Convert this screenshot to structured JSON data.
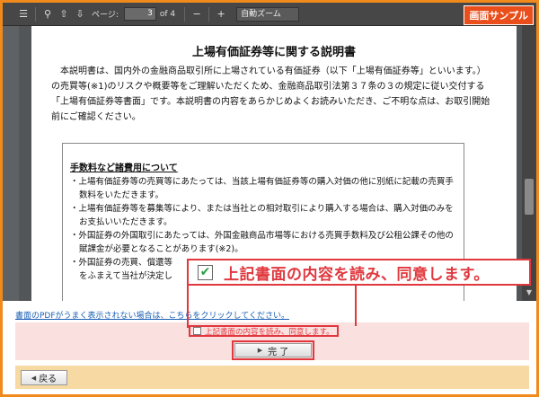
{
  "badge": "画面サンプル",
  "viewer": {
    "page_label": "ページ:",
    "page_current": "3",
    "page_total": "of 4",
    "zoom_minus": "−",
    "zoom_plus": "+",
    "zoom_value": "自動ズーム"
  },
  "document": {
    "title": "上場有価証券等に関する説明書",
    "intro": "本説明書は、国内外の金融商品取引所に上場されている有価証券（以下「上場有価証券等」といいます。）の売買等(※1)のリスクや概要等をご理解いただくため、金融商品取引法第３７条の３の規定に従い交付する「上場有価証券等書面」です。本説明書の内容をあらかじめよくお読みいただき、ご不明な点は、お取引開始前にご確認ください。",
    "fee_heading": "手数料など諸費用について",
    "fee_items": [
      "・上場有価証券等の売買等にあたっては、当該上場有価証券等の購入対価の他に別紙に記載の売買手数料をいただきます。",
      "・上場有価証券等を募集等により、または当社との相対取引により購入する場合は、購入対価のみをお支払いいただきます。",
      "・外国証券の外国取引にあたっては、外国金融商品市場等における売買手数料及び公租公課その他の賦課金が必要となることがあります(※2)。",
      "・外国証券の売買、償還等",
      "をふまえて当社が決定し"
    ]
  },
  "callout_text": "上記書面の内容を読み、同意します。",
  "pdf_link": "書面のPDFがうまく表示されない場合は、こちらをクリックしてください。",
  "agree_label": "上記書面の内容を読み、同意します。",
  "done_label": "完 了",
  "back_label": "戻る"
}
